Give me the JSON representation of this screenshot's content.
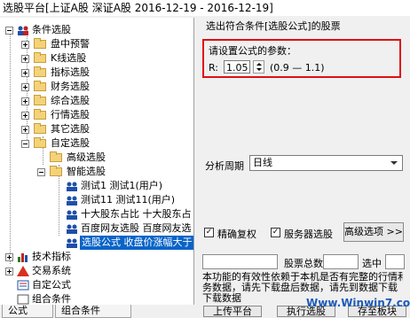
{
  "window": {
    "title": "选股平台[上证A股 深证A股  2016-12-19 - 2016-12-19]"
  },
  "tree": {
    "root": "条件选股",
    "items": {
      "pan": "盘中预警",
      "kline": "K线选股",
      "indicator": "指标选股",
      "finance": "财务选股",
      "composite": "综合选股",
      "market": "行情选股",
      "other": "其它选股",
      "custom": "自定选股",
      "advanced": "高级选股",
      "smart": "智能选股",
      "test1": "测试1  测试1(用户)",
      "test11": "测试11  测试11(用户)",
      "top10": "十大股东占比  十大股东占",
      "baidu1": "百度网友选股  百度网友选",
      "formula": "选股公式  收盘价涨幅大于",
      "tech": "技术指标",
      "trade": "交易系统",
      "customformula": "自定公式",
      "combo": "组合条件"
    }
  },
  "tabs": {
    "formula": "公式",
    "combo": "组合条件"
  },
  "panel": {
    "header": "选出符合条件[选股公式]的股票",
    "param_title": "请设置公式的参数：",
    "param_name": "R:",
    "param_value": "1.05",
    "param_range": "(0.9 — 1.1)",
    "period_label": "分析周期",
    "period_value": "日线",
    "chk_precise": "精确复权",
    "chk_server": "服务器选股",
    "btn_advanced": "高级选项 >>",
    "total_label": "股票总数",
    "selected_label": "选中",
    "desc_line1": "本功能的有效性依赖于本机是否有完整的行情和财",
    "desc_line2": "务数据，请先下载盘后数据，请先到数据下载",
    "desc_line3": "下载数据",
    "btn_upload": "上传平台",
    "btn_execute": "执行选股",
    "btn_save": "存至板块",
    "watermark": "Www.Winwin7.com"
  }
}
